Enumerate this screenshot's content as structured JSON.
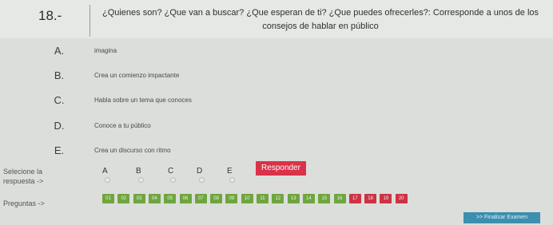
{
  "question": {
    "number": "18.-",
    "text": "¿Quienes son? ¿Que van a buscar? ¿Que esperan de ti? ¿Que puedes ofrecerles?: Corresponde a unos de los consejos de hablar en público"
  },
  "options": [
    {
      "letter": "A.",
      "text": "imagina"
    },
    {
      "letter": "B.",
      "text": "Crea un comienzo impactante"
    },
    {
      "letter": "C.",
      "text": "Habla sobre un tema que conoces"
    },
    {
      "letter": "D.",
      "text": "Conoce a tu público"
    },
    {
      "letter": "E.",
      "text": "Crea un discurso con ritmo"
    }
  ],
  "answer": {
    "label_line1": "Selecione la",
    "label_line2": "respuesta ->",
    "choices": [
      "A",
      "B",
      "C",
      "D",
      "E"
    ],
    "respond_label": "Responder"
  },
  "pagination": {
    "label": "Preguntas ->",
    "pages": [
      "01",
      "02",
      "03",
      "04",
      "05",
      "06",
      "07",
      "08",
      "09",
      "10",
      "11",
      "12",
      "13",
      "14",
      "15",
      "16",
      "17",
      "18",
      "19",
      "20"
    ],
    "colors": {
      "answered": "#6fa63c",
      "current": "#cc3344",
      "unanswered": "#cc3344"
    }
  },
  "finish_label": ">> Finalizar Examen"
}
